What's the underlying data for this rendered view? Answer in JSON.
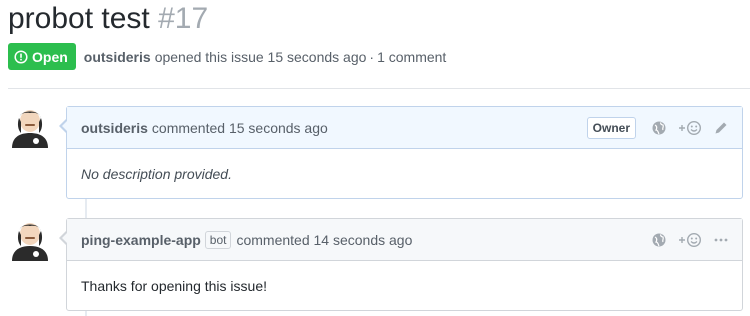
{
  "issue": {
    "title": "probot test",
    "number": "#17",
    "state": "Open",
    "author": "outsideris",
    "opened_text": "opened this issue 15 seconds ago",
    "separator": "·",
    "comment_count": "1 comment",
    "state_color": "#2cbe4e"
  },
  "comments": [
    {
      "author": "outsideris",
      "action_text": "commented 15 seconds ago",
      "role_label": "Owner",
      "body": "No description provided.",
      "icons": [
        "globe-icon",
        "add-reaction-icon",
        "pencil-icon"
      ]
    },
    {
      "author": "ping-example-app",
      "bot_label": "bot",
      "action_text": "commented 14 seconds ago",
      "body": "Thanks for opening this issue!",
      "icons": [
        "globe-icon",
        "add-reaction-icon",
        "more-icon"
      ]
    }
  ],
  "colors": {
    "owner_header_bg": "#f1f8ff",
    "header_bg": "#f6f8fa",
    "muted_text": "#586069"
  }
}
